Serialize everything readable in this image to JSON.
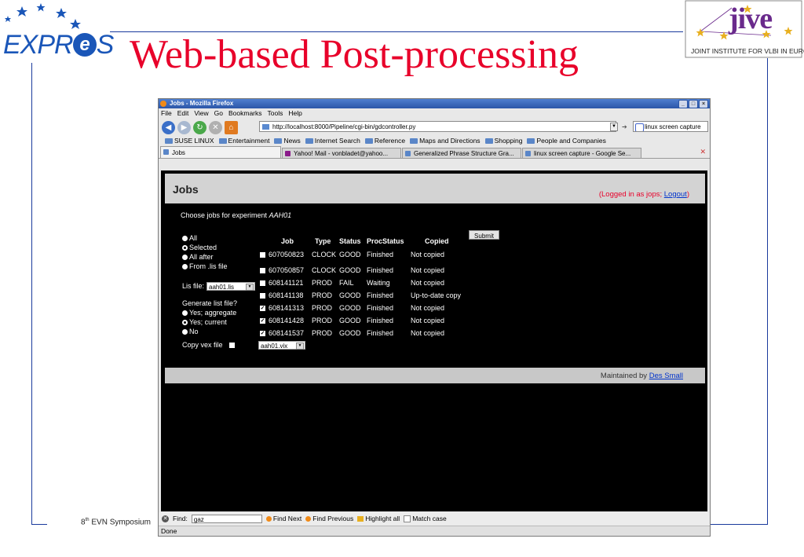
{
  "slide": {
    "title": "Web-based Post-processing",
    "logo_left_pre": "EXPR",
    "logo_left_ball": "e",
    "logo_left_post": "S",
    "logo_right_text": "jive",
    "logo_right_caption": "JOINT INSTITUTE FOR VLBI IN EUROPE",
    "footer_pre": "8",
    "footer_sup": "th",
    "footer_post": " EVN Symposium"
  },
  "browser": {
    "title": "Jobs - Mozilla Firefox",
    "menu": [
      "File",
      "Edit",
      "View",
      "Go",
      "Bookmarks",
      "Tools",
      "Help"
    ],
    "url": "http://localhost:8000/Pipeline/cgi-bin/gdcontroller.py",
    "search_value": "linux screen capture",
    "bookmarks": [
      "SUSE LINUX",
      "Entertainment",
      "News",
      "Internet Search",
      "Reference",
      "Maps and Directions",
      "Shopping",
      "People and Companies"
    ],
    "tabs": [
      "Jobs",
      "Yahoo! Mail - vonbladet@yahoo...",
      "Generalized Phrase Structure Gra...",
      "linux screen capture - Google Se..."
    ],
    "status": "Done"
  },
  "page": {
    "title": "Jobs",
    "logged_pre": "(Logged in as jops; ",
    "logout": "Logout",
    "logged_post": ")",
    "choose_pre": "Choose jobs for experiment ",
    "experiment": "AAH01",
    "select_options": [
      "All",
      "Selected",
      "All after",
      "From .lis file"
    ],
    "selected_option": "Selected",
    "lis_label": "Lis file:",
    "lis_value": "aah01.lis",
    "generate_label": "Generate list file?",
    "generate_options": [
      "Yes; aggregate",
      "Yes; current",
      "No"
    ],
    "generate_selected": "Yes; current",
    "copy_vex_label": "Copy vex file",
    "vex_value": "aah01.vix",
    "submit": "Submit",
    "columns": [
      "Job",
      "Type",
      "Status",
      "ProcStatus",
      "Copied"
    ],
    "jobs": [
      {
        "checked": false,
        "job": "607050823",
        "type": "CLOCK",
        "status": "GOOD",
        "procstatus": "Finished",
        "copied": "Not copied"
      },
      {
        "checked": false,
        "job": "607050857",
        "type": "CLOCK",
        "status": "GOOD",
        "procstatus": "Finished",
        "copied": "Not copied"
      },
      {
        "checked": false,
        "job": "608141121",
        "type": "PROD",
        "status": "FAIL",
        "procstatus": "Waiting",
        "copied": "Not copied"
      },
      {
        "checked": false,
        "job": "608141138",
        "type": "PROD",
        "status": "GOOD",
        "procstatus": "Finished",
        "copied": "Up-to-date copy"
      },
      {
        "checked": true,
        "job": "608141313",
        "type": "PROD",
        "status": "GOOD",
        "procstatus": "Finished",
        "copied": "Not copied"
      },
      {
        "checked": true,
        "job": "608141428",
        "type": "PROD",
        "status": "GOOD",
        "procstatus": "Finished",
        "copied": "Not copied"
      },
      {
        "checked": true,
        "job": "608141537",
        "type": "PROD",
        "status": "GOOD",
        "procstatus": "Finished",
        "copied": "Not copied"
      }
    ],
    "maintained_pre": "Maintained by ",
    "maintainer": "Des Small"
  },
  "findbar": {
    "label": "Find:",
    "value": "gaz",
    "next": "Find Next",
    "previous": "Find Previous",
    "highlight": "Highlight all",
    "match_case": "Match case"
  },
  "colors": {
    "title_red": "#e8002a",
    "rule_blue": "#1a3a9c",
    "page_bg": "#000000",
    "header_gray": "#d3d3d3"
  }
}
